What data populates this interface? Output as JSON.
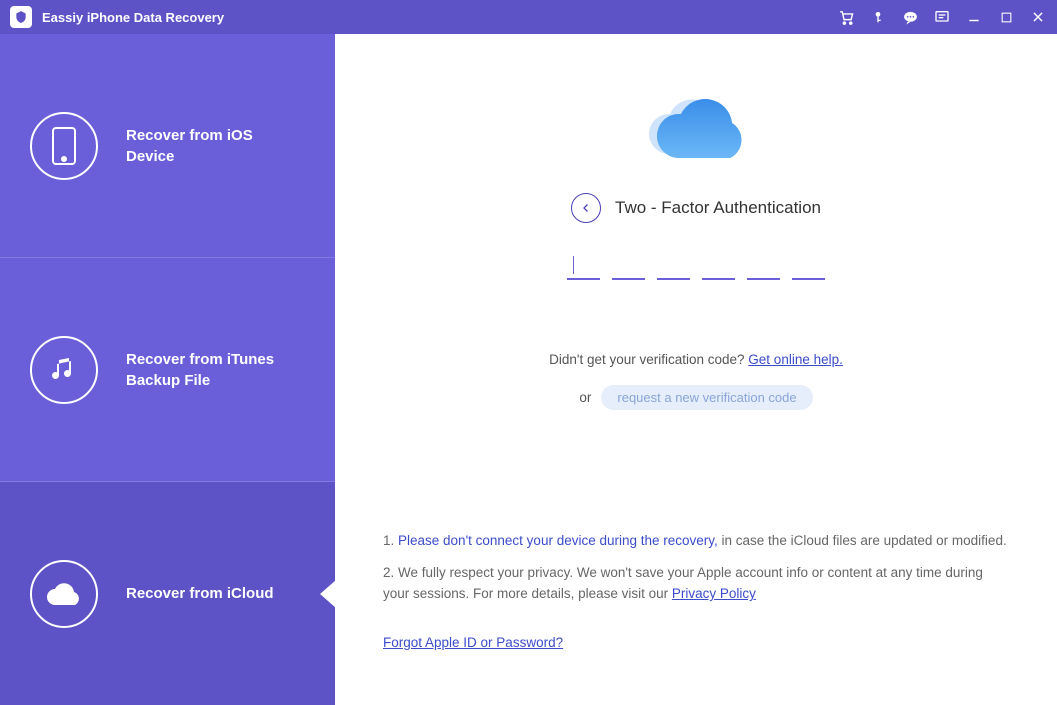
{
  "app": {
    "title": "Eassiy iPhone Data Recovery"
  },
  "sidebar": {
    "items": [
      {
        "label": "Recover from iOS Device"
      },
      {
        "label": "Recover from iTunes Backup File"
      },
      {
        "label": "Recover from iCloud"
      }
    ]
  },
  "main": {
    "heading": "Two - Factor Authentication",
    "help_prefix": "Didn't get your verification code? ",
    "help_link": "Get online help.",
    "or_text": "or",
    "request_button": "request a new verification code",
    "note1_prefix": "1. ",
    "note1_highlight": "Please don't connect your device during the recovery,",
    "note1_suffix": " in case the iCloud files are updated or modified.",
    "note2_prefix": "2. We fully respect your privacy. We won't save your Apple account info or content at any time during your sessions. For more details, please visit our ",
    "note2_link": "Privacy Policy",
    "forgot_link": "Forgot Apple ID or Password?"
  }
}
